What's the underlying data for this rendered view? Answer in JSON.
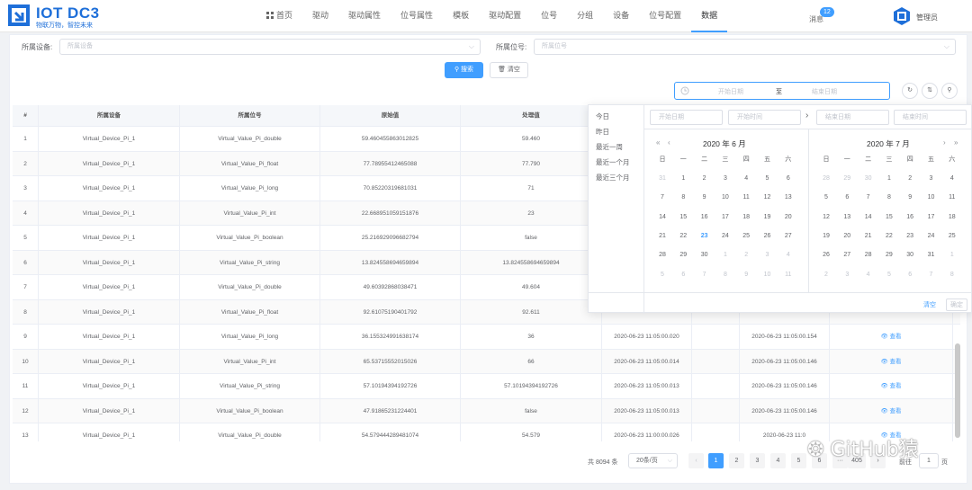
{
  "app": {
    "title": "IOT DC3",
    "subtitle": "物联万物，智控未来"
  },
  "nav": {
    "items": [
      {
        "label": "首页"
      },
      {
        "label": "驱动"
      },
      {
        "label": "驱动属性"
      },
      {
        "label": "位号属性"
      },
      {
        "label": "模板"
      },
      {
        "label": "驱动配置"
      },
      {
        "label": "位号"
      },
      {
        "label": "分组"
      },
      {
        "label": "设备"
      },
      {
        "label": "位号配置"
      },
      {
        "label": "数据"
      }
    ],
    "active": "数据"
  },
  "user": {
    "messages_label": "消息",
    "messages_count": "12",
    "name": "管理员"
  },
  "filters": {
    "device_label": "所属设备:",
    "device_placeholder": "所属设备",
    "point_label": "所属位号:",
    "point_placeholder": "所属位号",
    "search_label": "搜索",
    "clear_label": "清空",
    "date_start_placeholder": "开始日期",
    "date_sep": "至",
    "date_end_placeholder": "结束日期"
  },
  "table": {
    "columns": [
      "#",
      "所属设备",
      "所属位号",
      "原始值",
      "处理值",
      "",
      "",
      ""
    ],
    "op_label": "查看",
    "rows": [
      {
        "n": "1",
        "device": "Virtual_Device_Pi_1",
        "point": "Virtual_Value_Pi_double",
        "raw": "59.460455863012825",
        "value": "59.460",
        "t1": "",
        "t2": "",
        "op": false
      },
      {
        "n": "2",
        "device": "Virtual_Device_Pi_1",
        "point": "Virtual_Value_Pi_float",
        "raw": "77.78955412465088",
        "value": "77.790",
        "t1": "",
        "t2": "",
        "op": false
      },
      {
        "n": "3",
        "device": "Virtual_Device_Pi_1",
        "point": "Virtual_Value_Pi_long",
        "raw": "70.85220319681031",
        "value": "71",
        "t1": "",
        "t2": "",
        "op": false
      },
      {
        "n": "4",
        "device": "Virtual_Device_Pi_1",
        "point": "Virtual_Value_Pi_int",
        "raw": "22.668951059151876",
        "value": "23",
        "t1": "",
        "t2": "",
        "op": false
      },
      {
        "n": "5",
        "device": "Virtual_Device_Pi_1",
        "point": "Virtual_Value_Pi_boolean",
        "raw": "25.216929096682794",
        "value": "false",
        "t1": "",
        "t2": "",
        "op": false
      },
      {
        "n": "6",
        "device": "Virtual_Device_Pi_1",
        "point": "Virtual_Value_Pi_string",
        "raw": "13.824558694659894",
        "value": "13.824558694659894",
        "t1": "",
        "t2": "",
        "op": false
      },
      {
        "n": "7",
        "device": "Virtual_Device_Pi_1",
        "point": "Virtual_Value_Pi_double",
        "raw": "49.60392868038471",
        "value": "49.604",
        "t1": "",
        "t2": "",
        "op": false
      },
      {
        "n": "8",
        "device": "Virtual_Device_Pi_1",
        "point": "Virtual_Value_Pi_float",
        "raw": "92.61075190401792",
        "value": "92.611",
        "t1": "",
        "t2": "",
        "op": false
      },
      {
        "n": "9",
        "device": "Virtual_Device_Pi_1",
        "point": "Virtual_Value_Pi_long",
        "raw": "36.155324991638174",
        "value": "36",
        "t1": "2020-06-23 11:05:00.020",
        "t2": "2020-06-23 11:05:00.154",
        "op": true
      },
      {
        "n": "10",
        "device": "Virtual_Device_Pi_1",
        "point": "Virtual_Value_Pi_int",
        "raw": "65.53715552015026",
        "value": "66",
        "t1": "2020-06-23 11:05:00.014",
        "t2": "2020-06-23 11:05:00.146",
        "op": true
      },
      {
        "n": "11",
        "device": "Virtual_Device_Pi_1",
        "point": "Virtual_Value_Pi_string",
        "raw": "57.10194394192726",
        "value": "57.10194394192726",
        "t1": "2020-06-23 11:05:00.013",
        "t2": "2020-06-23 11:05:00.146",
        "op": true
      },
      {
        "n": "12",
        "device": "Virtual_Device_Pi_1",
        "point": "Virtual_Value_Pi_boolean",
        "raw": "47.91865231224401",
        "value": "false",
        "t1": "2020-06-23 11:05:00.013",
        "t2": "2020-06-23 11:05:00.146",
        "op": true
      },
      {
        "n": "13",
        "device": "Virtual_Device_Pi_1",
        "point": "Virtual_Value_Pi_double",
        "raw": "54.579444289481074",
        "value": "54.579",
        "t1": "2020-06-23 11:00:00.026",
        "t2": "2020-06-23 11:0",
        "op": true
      }
    ]
  },
  "picker": {
    "shortcuts": [
      "今日",
      "昨日",
      "最近一周",
      "最近一个月",
      "最近三个月"
    ],
    "start_date_ph": "开始日期",
    "start_time_ph": "开始时间",
    "end_date_ph": "结束日期",
    "end_time_ph": "结束时间",
    "left_title": "2020 年 6 月",
    "right_title": "2020 年 7 月",
    "weekdays": [
      "日",
      "一",
      "二",
      "三",
      "四",
      "五",
      "六"
    ],
    "left_days": [
      [
        "31",
        "o"
      ],
      [
        "1",
        "c"
      ],
      [
        "2",
        "c"
      ],
      [
        "3",
        "c"
      ],
      [
        "4",
        "c"
      ],
      [
        "5",
        "c"
      ],
      [
        "6",
        "c"
      ],
      [
        "7",
        "c"
      ],
      [
        "8",
        "c"
      ],
      [
        "9",
        "c"
      ],
      [
        "10",
        "c"
      ],
      [
        "11",
        "c"
      ],
      [
        "12",
        "c"
      ],
      [
        "13",
        "c"
      ],
      [
        "14",
        "c"
      ],
      [
        "15",
        "c"
      ],
      [
        "16",
        "c"
      ],
      [
        "17",
        "c"
      ],
      [
        "18",
        "c"
      ],
      [
        "19",
        "c"
      ],
      [
        "20",
        "c"
      ],
      [
        "21",
        "c"
      ],
      [
        "22",
        "c"
      ],
      [
        "23",
        "t"
      ],
      [
        "24",
        "c"
      ],
      [
        "25",
        "c"
      ],
      [
        "26",
        "c"
      ],
      [
        "27",
        "c"
      ],
      [
        "28",
        "c"
      ],
      [
        "29",
        "c"
      ],
      [
        "30",
        "c"
      ],
      [
        "1",
        "o"
      ],
      [
        "2",
        "o"
      ],
      [
        "3",
        "o"
      ],
      [
        "4",
        "o"
      ],
      [
        "5",
        "o"
      ],
      [
        "6",
        "o"
      ],
      [
        "7",
        "o"
      ],
      [
        "8",
        "o"
      ],
      [
        "9",
        "o"
      ],
      [
        "10",
        "o"
      ],
      [
        "11",
        "o"
      ]
    ],
    "right_days": [
      [
        "28",
        "o"
      ],
      [
        "29",
        "o"
      ],
      [
        "30",
        "o"
      ],
      [
        "1",
        "c"
      ],
      [
        "2",
        "c"
      ],
      [
        "3",
        "c"
      ],
      [
        "4",
        "c"
      ],
      [
        "5",
        "c"
      ],
      [
        "6",
        "c"
      ],
      [
        "7",
        "c"
      ],
      [
        "8",
        "c"
      ],
      [
        "9",
        "c"
      ],
      [
        "10",
        "c"
      ],
      [
        "11",
        "c"
      ],
      [
        "12",
        "c"
      ],
      [
        "13",
        "c"
      ],
      [
        "14",
        "c"
      ],
      [
        "15",
        "c"
      ],
      [
        "16",
        "c"
      ],
      [
        "17",
        "c"
      ],
      [
        "18",
        "c"
      ],
      [
        "19",
        "c"
      ],
      [
        "20",
        "c"
      ],
      [
        "21",
        "c"
      ],
      [
        "22",
        "c"
      ],
      [
        "23",
        "c"
      ],
      [
        "24",
        "c"
      ],
      [
        "25",
        "c"
      ],
      [
        "26",
        "c"
      ],
      [
        "27",
        "c"
      ],
      [
        "28",
        "c"
      ],
      [
        "29",
        "c"
      ],
      [
        "30",
        "c"
      ],
      [
        "31",
        "c"
      ],
      [
        "1",
        "o"
      ],
      [
        "2",
        "o"
      ],
      [
        "3",
        "o"
      ],
      [
        "4",
        "o"
      ],
      [
        "5",
        "o"
      ],
      [
        "6",
        "o"
      ],
      [
        "7",
        "o"
      ],
      [
        "8",
        "o"
      ]
    ],
    "clear_label": "清空",
    "ok_label": "确定"
  },
  "pagination": {
    "total": "共 8094 条",
    "page_size": "20条/页",
    "pages": [
      "1",
      "2",
      "3",
      "4",
      "5",
      "6",
      "···",
      "405"
    ],
    "current": "1",
    "goto_label": "前往",
    "goto_value": "1",
    "page_suffix": "页"
  },
  "watermark": "GitHub猿",
  "colors": {
    "primary": "#409eff",
    "brand": "#1e6fd9"
  }
}
